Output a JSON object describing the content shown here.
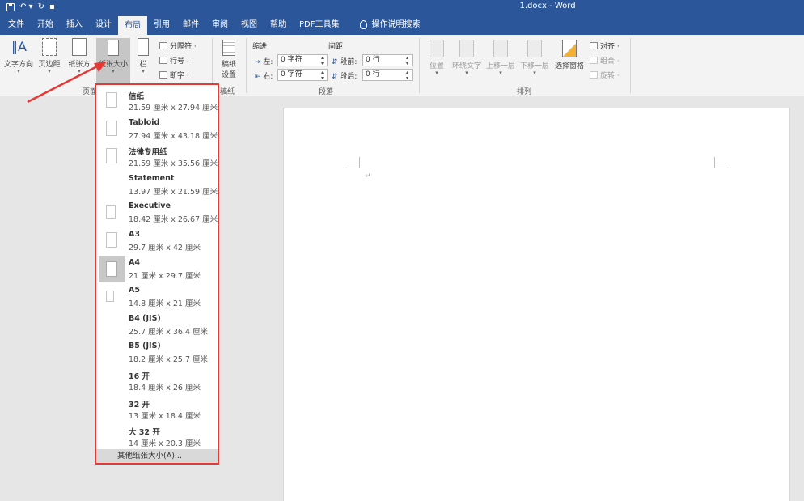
{
  "titlebar": {
    "doc_title": "1.docx  -  Word",
    "qat": {
      "undo": "↶ ▾",
      "redo": "↻",
      "customize": "▪"
    }
  },
  "tabs": [
    "文件",
    "开始",
    "插入",
    "设计",
    "布局",
    "引用",
    "邮件",
    "审阅",
    "视图",
    "帮助",
    "PDF工具集"
  ],
  "active_tab": "布局",
  "tell_me": "操作说明搜索",
  "ribbon": {
    "page_setup": {
      "text_direction": "文字方向",
      "margins": "页边距",
      "orientation": "纸张方",
      "size": "纸张大小",
      "columns": "栏",
      "breaks": "分隔符 ·",
      "line_numbers": "行号 ·",
      "hyphenation": "断字 ·",
      "label": "页面"
    },
    "manuscript": {
      "button_line1": "稿纸",
      "button_line2": "设置",
      "label": "稿纸"
    },
    "paragraph": {
      "indent_label": "缩进",
      "spacing_label": "间距",
      "left_label": "左:",
      "left_value": "0 字符",
      "right_label": "右:",
      "right_value": "0 字符",
      "before_label": "段前:",
      "before_value": "0 行",
      "after_label": "段后:",
      "after_value": "0 行",
      "label": "段落"
    },
    "arrange": {
      "position": "位置",
      "wrap_text": "环绕文字",
      "bring_forward": "上移一层",
      "send_backward": "下移一层",
      "selection_pane": "选择窗格",
      "align": "对齐 ·",
      "group": "组合 ·",
      "rotate": "旋转 ·",
      "label": "排列"
    }
  },
  "paper_sizes": [
    {
      "name": "信纸",
      "dims": "21.59 厘米 x 27.94 厘米"
    },
    {
      "name": "Tabloid",
      "dims": "27.94 厘米 x 43.18 厘米"
    },
    {
      "name": "法律专用纸",
      "dims": "21.59 厘米 x 35.56 厘米"
    },
    {
      "name": "Statement",
      "dims": "13.97 厘米 x 21.59 厘米"
    },
    {
      "name": "Executive",
      "dims": "18.42 厘米 x 26.67 厘米"
    },
    {
      "name": "A3",
      "dims": "29.7 厘米 x 42 厘米"
    },
    {
      "name": "A4",
      "dims": "21 厘米 x 29.7 厘米"
    },
    {
      "name": "A5",
      "dims": "14.8 厘米 x 21 厘米"
    },
    {
      "name": "B4 (JIS)",
      "dims": "25.7 厘米 x 36.4 厘米"
    },
    {
      "name": "B5 (JIS)",
      "dims": "18.2 厘米 x 25.7 厘米"
    },
    {
      "name": "16 开",
      "dims": "18.4 厘米 x 26 厘米"
    },
    {
      "name": "32 开",
      "dims": "13 厘米 x 18.4 厘米"
    },
    {
      "name": "大 32 开",
      "dims": "14 厘米 x 20.3 厘米"
    }
  ],
  "selected_paper": "A4",
  "more_sizes": "其他纸张大小(A)...",
  "document": {
    "paragraph_mark": "↵"
  },
  "colors": {
    "brand": "#2b579a",
    "highlight": "#e53935"
  }
}
